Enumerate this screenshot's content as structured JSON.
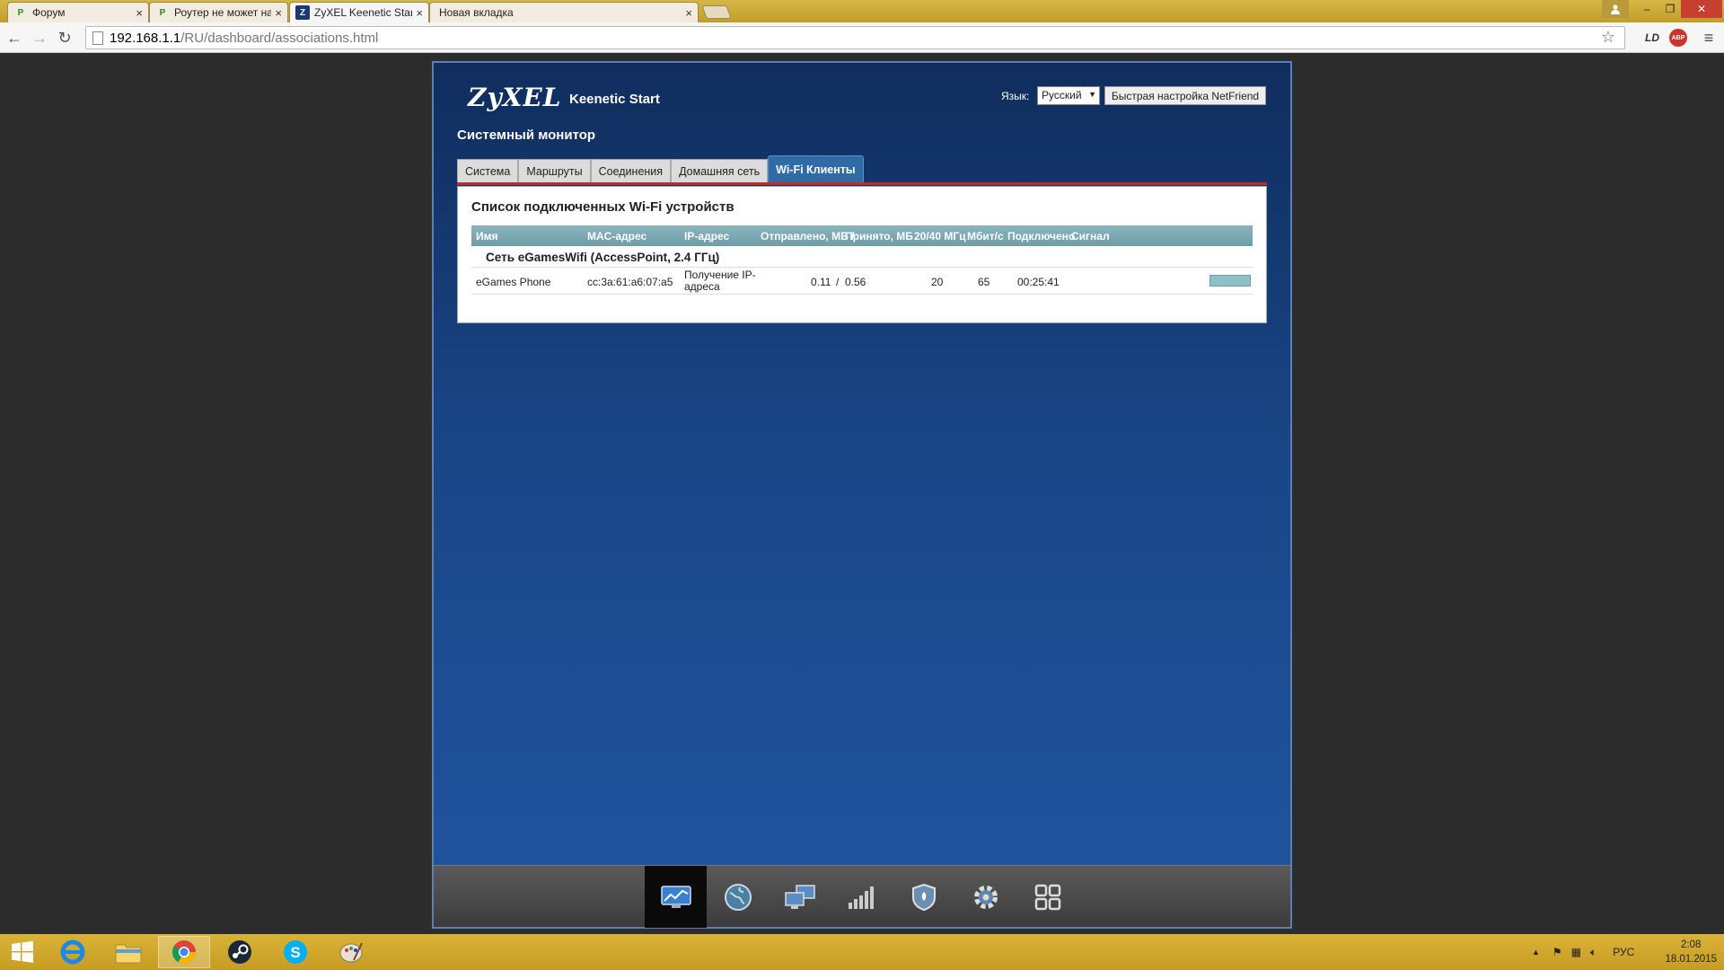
{
  "browser": {
    "tabs": [
      {
        "title": "Форум",
        "icon": "P"
      },
      {
        "title": "Роутер не может назначи",
        "icon": "P"
      },
      {
        "title": "ZyXEL Keenetic Start - Wi",
        "icon": "Z"
      },
      {
        "title": "Новая вкладка",
        "icon": ""
      }
    ],
    "url_host": "192.168.1.1",
    "url_path": "/RU/dashboard/associations.html",
    "ext_ld": "LD",
    "ext_abp": "ABP"
  },
  "router": {
    "brand": "ZyXEL",
    "model": "Keenetic Start",
    "language_label": "Язык:",
    "language_value": "Русский",
    "netfriend_button": "Быстрая настройка NetFriend",
    "page_title": "Системный монитор",
    "tabs": [
      "Система",
      "Маршруты",
      "Соединения",
      "Домашняя сеть",
      "Wi-Fi Клиенты"
    ],
    "panel_title": "Список подключенных Wi-Fi устройств",
    "columns": {
      "name": "Имя",
      "mac": "MAC-адрес",
      "ip": "IP-адрес",
      "sent": "Отправлено, МБ /",
      "received": "Принято, МБ",
      "width": "20/40 МГц",
      "rate": "Мбит/с",
      "connected": "Подключено",
      "signal": "Сигнал"
    },
    "network_group": "Сеть eGamesWifi (AccessPoint, 2.4 ГГц)",
    "clients": [
      {
        "name": "eGames Phone",
        "mac": "cc:3a:61:a6:07:a5",
        "ip": "Получение IP-адреса",
        "sent": "0.11",
        "separator": "/",
        "received": "0.56",
        "width": "20",
        "rate": "65",
        "connected": "00:25:41"
      }
    ],
    "footer_icons": [
      "monitor-chart-icon",
      "globe-icon",
      "network-computers-icon",
      "signal-bars-icon",
      "shield-icon",
      "gear-icon",
      "apps-grid-icon"
    ]
  },
  "taskbar": {
    "language": "РУС",
    "time": "2:08",
    "date": "18.01.2015"
  },
  "colors": {
    "accent_tab": "#2f6ba4",
    "tab_underline": "#c52a2a",
    "grid_header": "#7aa9b2",
    "taskbar": "#d0a82e"
  }
}
